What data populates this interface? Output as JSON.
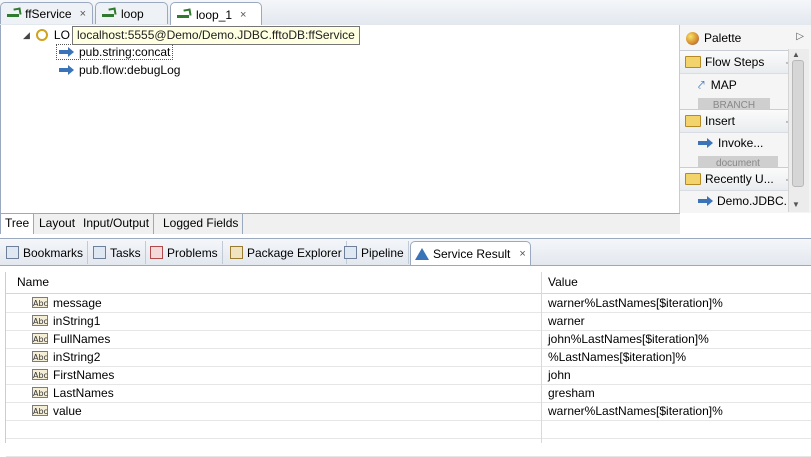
{
  "editor_tabs": [
    {
      "label": "ffService",
      "close": "×"
    },
    {
      "label": "loop",
      "close": "×"
    },
    {
      "label": "loop_1",
      "close": "×"
    }
  ],
  "tree": {
    "root_label": "LO",
    "tooltip": "localhost:5555@Demo/Demo.JDBC.fftoDB:ffService",
    "items": [
      "pub.string:concat",
      "pub.flow:debugLog"
    ]
  },
  "palette": {
    "title": "Palette",
    "groups": [
      {
        "label": "Flow Steps",
        "item": "MAP",
        "partial": "BRANCH"
      },
      {
        "label": "Insert",
        "item": "Invoke...",
        "partial": "document"
      },
      {
        "label": "Recently U...",
        "item": "Demo.JDBC...."
      }
    ]
  },
  "editor_bottom_tabs": [
    "Tree",
    "Layout",
    "Input/Output",
    "Logged Fields"
  ],
  "view_tabs": [
    {
      "label": "Bookmarks",
      "icon": "bookmarks-icon"
    },
    {
      "label": "Tasks",
      "icon": "tasks-icon"
    },
    {
      "label": "Problems",
      "icon": "problems-icon"
    },
    {
      "label": "Package Explorer",
      "icon": "package-explorer-icon"
    },
    {
      "label": "Pipeline",
      "icon": "pipeline-icon"
    },
    {
      "label": "Service Result",
      "icon": "service-result-icon",
      "close": "×"
    }
  ],
  "result_table": {
    "columns": [
      "Name",
      "Value"
    ],
    "rows": [
      {
        "icon": "Abc",
        "name": "message",
        "value": "warner%LastNames[$iteration]%"
      },
      {
        "icon": "Abc",
        "name": "inString1",
        "value": "warner"
      },
      {
        "icon": "Abc",
        "name": "FullNames",
        "value": "john%LastNames[$iteration]%"
      },
      {
        "icon": "Abc",
        "name": "inString2",
        "value": "%LastNames[$iteration]%"
      },
      {
        "icon": "Abc",
        "name": "FirstNames",
        "value": "john"
      },
      {
        "icon": "Abc",
        "name": "LastNames",
        "value": "gresham"
      },
      {
        "icon": "Abc",
        "name": "value",
        "value": "warner%LastNames[$iteration]%"
      }
    ]
  }
}
